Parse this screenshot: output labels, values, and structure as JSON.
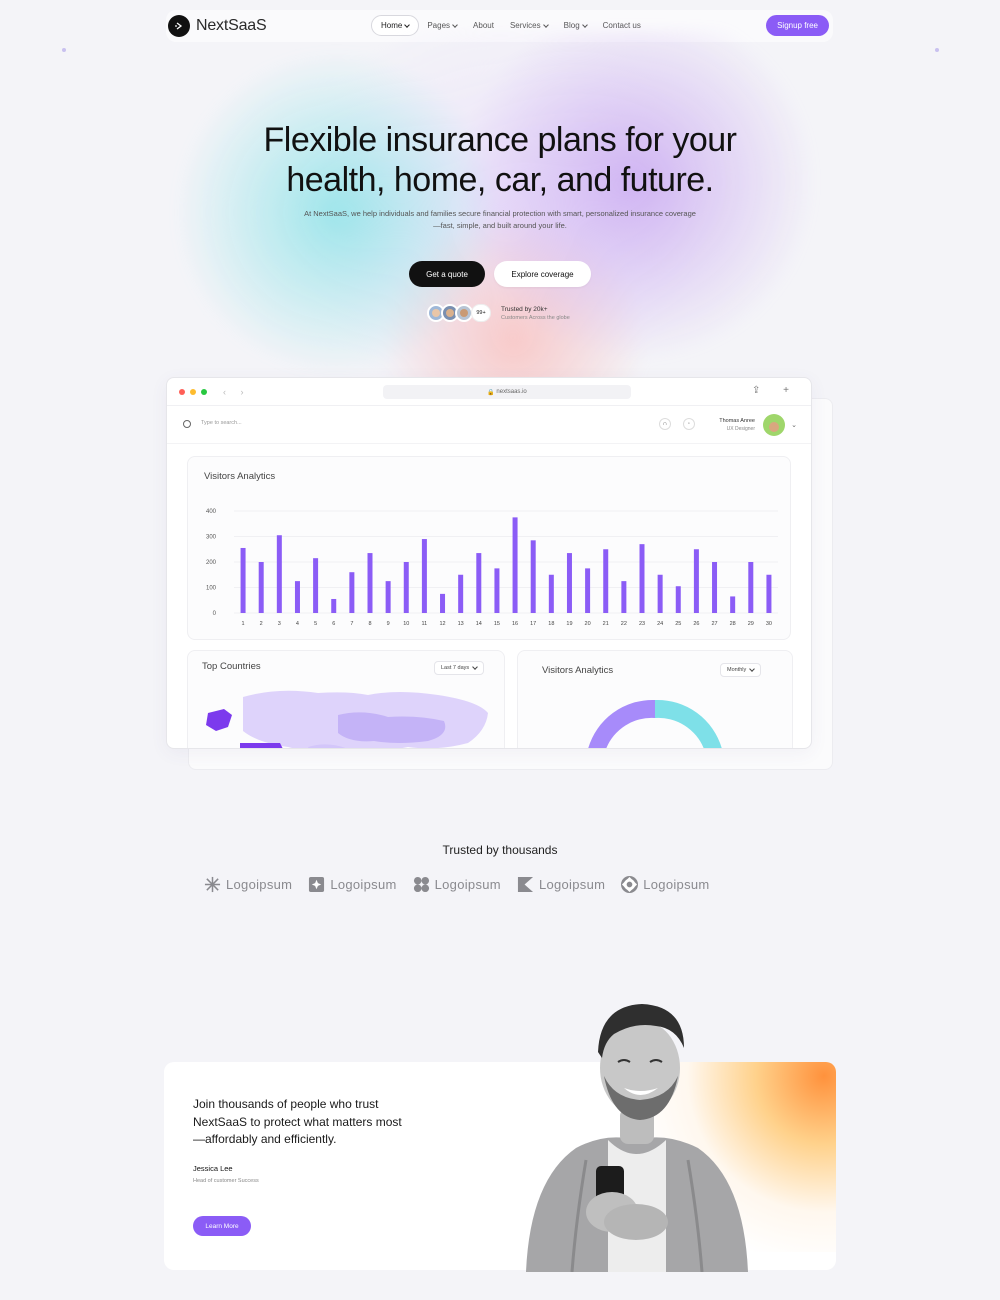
{
  "brand": {
    "name": "NextSaaS"
  },
  "nav": {
    "links": [
      {
        "label": "Home",
        "dropdown": true,
        "active": true
      },
      {
        "label": "Pages",
        "dropdown": true
      },
      {
        "label": "About",
        "dropdown": false
      },
      {
        "label": "Services",
        "dropdown": true
      },
      {
        "label": "Blog",
        "dropdown": true
      },
      {
        "label": "Contact us",
        "dropdown": false
      }
    ],
    "signup_label": "Signup free"
  },
  "hero": {
    "title_line1": "Flexible insurance plans for your",
    "title_line2": "health, home, car, and future.",
    "subtitle_line1": "At NextSaaS, we help individuals and families secure financial protection with smart, personalized insurance coverage",
    "subtitle_line2": "—fast, simple, and built around your life.",
    "cta_primary": "Get a quote",
    "cta_secondary": "Explore coverage",
    "avatar_count": "99+",
    "trust_line1": "Trusted by 20k+",
    "trust_line2": "Customers Across the globe"
  },
  "dashboard": {
    "url": "nextsaas.io",
    "search_placeholder": "Type to search...",
    "user_name": "Thomas Anree",
    "user_role": "UX Designer",
    "visitors_title": "Visitors Analytics",
    "countries_title": "Top Countries",
    "countries_filter": "Last 7 days",
    "donut_title": "Visitors Analytics",
    "donut_filter": "Monthly",
    "accent": "#8b5cf6",
    "donut_colors": [
      "#a78bfa",
      "#7ee0e8"
    ]
  },
  "chart_data": {
    "type": "bar",
    "title": "Visitors Analytics",
    "categories": [
      "1",
      "2",
      "3",
      "4",
      "5",
      "6",
      "7",
      "8",
      "9",
      "10",
      "11",
      "12",
      "13",
      "14",
      "15",
      "16",
      "17",
      "18",
      "19",
      "20",
      "21",
      "22",
      "23",
      "24",
      "25",
      "26",
      "27",
      "28",
      "29",
      "30"
    ],
    "values": [
      255,
      200,
      305,
      125,
      215,
      55,
      160,
      235,
      125,
      200,
      290,
      75,
      150,
      235,
      175,
      375,
      285,
      150,
      235,
      175,
      250,
      125,
      270,
      150,
      105,
      250,
      200,
      65,
      200,
      150
    ],
    "yticks": [
      "0",
      "100",
      "200",
      "300",
      "400"
    ],
    "ylim": [
      0,
      400
    ],
    "grid": true
  },
  "trusted": {
    "title": "Trusted by thousands",
    "logos": [
      "Logoipsum",
      "Logoipsum",
      "Logoipsum",
      "Logoipsum",
      "Logoipsum"
    ]
  },
  "testimonial": {
    "quote_line1": "Join thousands of people who trust",
    "quote_line2": "NextSaaS to protect what matters most",
    "quote_line3": "—affordably and efficiently.",
    "author": "Jessica Lee",
    "author_role": "Head of customer Success",
    "button_label": "Learn More"
  }
}
